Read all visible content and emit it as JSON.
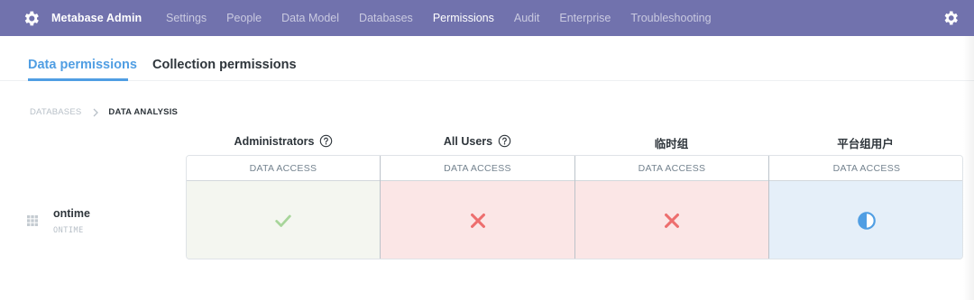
{
  "app": {
    "brand_label": "Metabase Admin"
  },
  "nav": {
    "items": [
      {
        "label": "Settings"
      },
      {
        "label": "People"
      },
      {
        "label": "Data Model"
      },
      {
        "label": "Databases"
      },
      {
        "label": "Permissions"
      },
      {
        "label": "Audit"
      },
      {
        "label": "Enterprise"
      },
      {
        "label": "Troubleshooting"
      }
    ],
    "active": "Permissions"
  },
  "tabs": {
    "data_permissions": "Data permissions",
    "collection_permissions": "Collection permissions",
    "active": "Data permissions"
  },
  "breadcrumb": {
    "databases": "DATABASES",
    "current": "DATA ANALYSIS"
  },
  "groups": [
    {
      "name": "Administrators",
      "has_help": true,
      "column_label": "DATA ACCESS",
      "access": "all",
      "icon": "check-icon"
    },
    {
      "name": "All Users",
      "has_help": true,
      "column_label": "DATA ACCESS",
      "access": "none",
      "icon": "close-icon"
    },
    {
      "name": "临时组",
      "has_help": false,
      "column_label": "DATA ACCESS",
      "access": "none",
      "icon": "close-icon"
    },
    {
      "name": "平台组用户",
      "has_help": false,
      "column_label": "DATA ACCESS",
      "access": "limited",
      "icon": "half-circle-icon"
    }
  ],
  "rows": [
    {
      "name": "ontime",
      "schema": "ONTIME",
      "icon": "table-grid-icon"
    }
  ],
  "colors": {
    "nav_background": "#7172ad",
    "accent": "#509ee3",
    "access_all": "#a7d59a",
    "access_none": "#ed6e6e",
    "access_limited": "#509ee3"
  }
}
